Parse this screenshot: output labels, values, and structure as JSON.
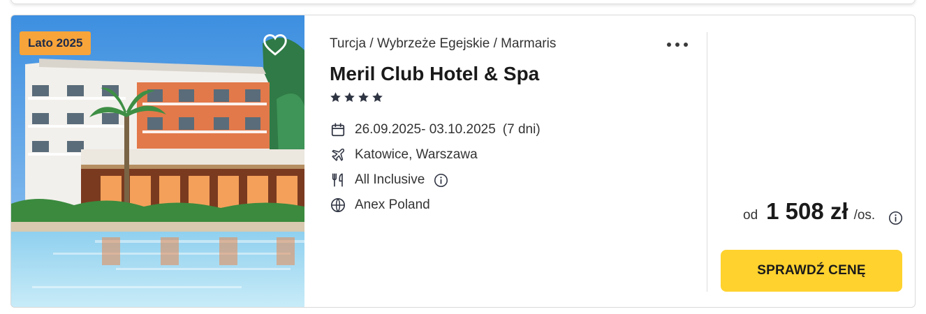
{
  "offer": {
    "badge": "Lato 2025",
    "image_alt": "Meril Club Hotel & Spa",
    "breadcrumb": [
      "Turcja",
      "Wybrzeże Egejskie",
      "Marmaris"
    ],
    "breadcrumb_separator": "/",
    "hotel_name": "Meril Club Hotel & Spa",
    "star_rating": 4,
    "details": {
      "dates": "26.09.2025- 03.10.2025",
      "duration": "(7 dni)",
      "departure": "Katowice, Warszawa",
      "board": "All Inclusive",
      "operator": "Anex Poland"
    },
    "icons": {
      "favorite": "heart-icon",
      "more": "more-dots-icon",
      "dates": "calendar-icon",
      "departure": "plane-icon",
      "board": "cutlery-icon",
      "operator": "globe-icon",
      "info": "info-icon",
      "star": "star-icon"
    },
    "price": {
      "prefix": "od",
      "amount": "1 508 zł",
      "suffix": "/os."
    },
    "cta_label": "SPRAWDŹ CENĘ"
  },
  "colors": {
    "badge_bg": "#f7a43a",
    "badge_text": "#1c2a4a",
    "cta_bg": "#ffd22e",
    "icon_dark": "#2f3442",
    "star": "#2f3442"
  }
}
